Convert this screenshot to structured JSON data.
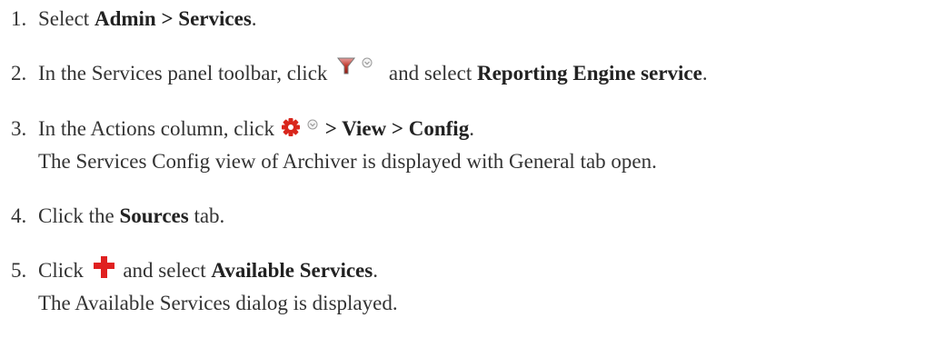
{
  "steps": [
    {
      "number": "1.",
      "parts": {
        "a": "Select ",
        "b": "Admin > Services",
        "c": "."
      }
    },
    {
      "number": "2.",
      "parts": {
        "a": "In the Services panel toolbar, click ",
        "b": " and select ",
        "c": "Reporting Engine service",
        "d": "."
      },
      "icon": "filter-dropdown-icon"
    },
    {
      "number": "3.",
      "parts": {
        "a": "In the Actions column, click ",
        "b": "> View > Config",
        "c": "."
      },
      "icon": "gear-dropdown-icon",
      "note": "The Services Config view of Archiver is displayed with General tab open."
    },
    {
      "number": "4.",
      "parts": {
        "a": "Click the ",
        "b": "Sources",
        "c": " tab."
      }
    },
    {
      "number": "5.",
      "parts": {
        "a": "Click ",
        "b": " and select ",
        "c": "Available Services",
        "d": "."
      },
      "icon": "add-plus-icon",
      "note": "The Available Services dialog is displayed."
    }
  ],
  "colors": {
    "text": "#333333",
    "filter_red": "#c0392b",
    "gear_red": "#d9261c",
    "plus_red": "#e02020",
    "dropdown_gray": "#9a9a9a"
  }
}
